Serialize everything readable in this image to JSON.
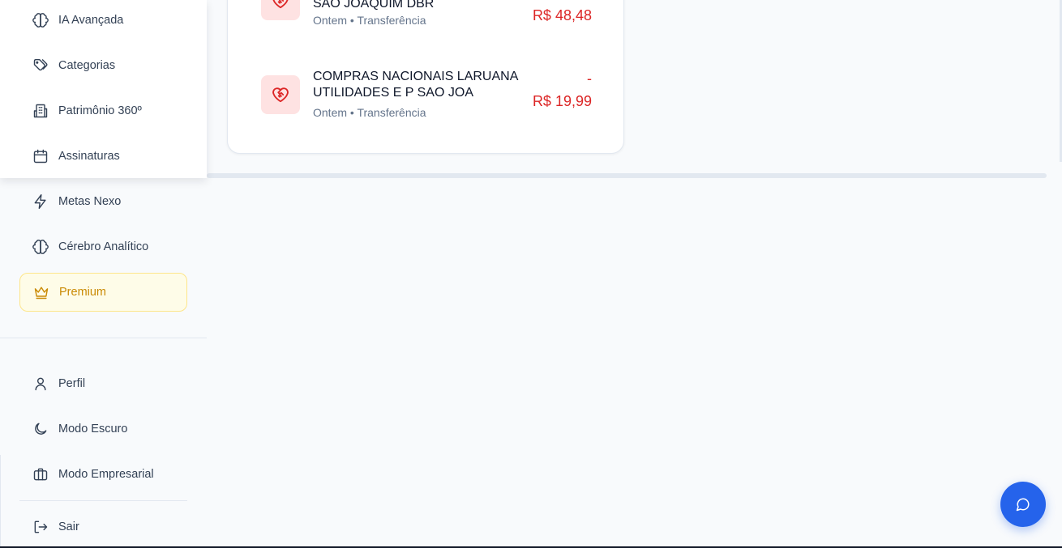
{
  "sidebar": {
    "top_items": [
      {
        "label": "IA Avançada",
        "icon": "brain-icon"
      },
      {
        "label": "Categorias",
        "icon": "tags-icon"
      },
      {
        "label": "Patrimônio 360º",
        "icon": "building-icon"
      },
      {
        "label": "Assinaturas",
        "icon": "calendar-icon"
      }
    ],
    "items": [
      {
        "label": "Metas Nexo",
        "icon": "zap-icon"
      },
      {
        "label": "Cérebro Analítico",
        "icon": "brain-icon"
      }
    ],
    "premium": {
      "label": "Premium",
      "icon": "crown-icon",
      "color": "#ca8a04"
    },
    "bottom_items": [
      {
        "label": "Perfil",
        "icon": "user-icon"
      },
      {
        "label": "Modo Escuro",
        "icon": "moon-icon"
      },
      {
        "label": "Modo Empresarial",
        "icon": "briefcase-icon"
      }
    ],
    "logout": {
      "label": "Sair",
      "icon": "logout-icon"
    }
  },
  "transactions": [
    {
      "title": "SAO JOAQUIM DBR",
      "meta": "Ontem • Transferência",
      "amount": "R$ 48,48",
      "icon": "heart-handshake-icon"
    },
    {
      "title": "COMPRAS NACIONAIS LARUANA UTILIDADES E P SAO JOA",
      "meta": "Ontem • Transferência",
      "amount_sign": "-",
      "amount": "R$ 19,99",
      "icon": "heart-handshake-icon"
    }
  ],
  "chat": {
    "icon": "message-circle-icon",
    "color": "#2563eb"
  },
  "colors": {
    "expense": "#dc2626",
    "accent": "#2563eb",
    "premium": "#ca8a04"
  }
}
